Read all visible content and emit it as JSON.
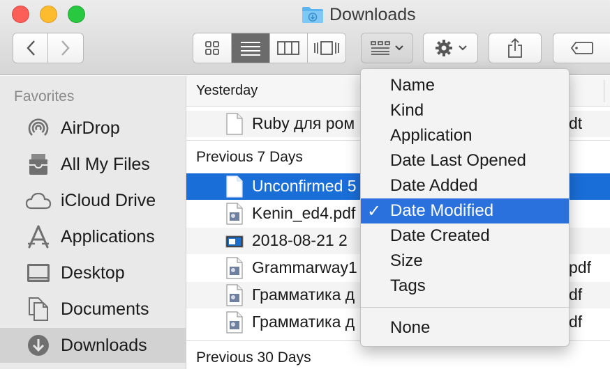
{
  "window": {
    "title": "Downloads"
  },
  "toolbar": {
    "back_icon": "chevron-left-icon",
    "forward_icon": "chevron-right-icon",
    "view_modes": [
      "icon-view-icon",
      "list-view-icon",
      "column-view-icon",
      "cover-flow-icon"
    ],
    "active_view": "list-view-icon",
    "group_icon": "group-by-icon",
    "action_icon": "gear-icon",
    "share_icon": "share-icon",
    "tag_icon": "tag-icon"
  },
  "sidebar": {
    "heading": "Favorites",
    "items": [
      {
        "label": "AirDrop",
        "icon": "airdrop-icon"
      },
      {
        "label": "All My Files",
        "icon": "all-files-icon"
      },
      {
        "label": "iCloud Drive",
        "icon": "cloud-icon"
      },
      {
        "label": "Applications",
        "icon": "applications-icon"
      },
      {
        "label": "Desktop",
        "icon": "desktop-icon"
      },
      {
        "label": "Documents",
        "icon": "documents-icon"
      },
      {
        "label": "Downloads",
        "icon": "downloads-icon"
      }
    ],
    "selected": "Downloads"
  },
  "list": {
    "groups": [
      {
        "label": "Yesterday",
        "rows": [
          {
            "name": "Ruby для ром",
            "ext": "dt"
          }
        ]
      },
      {
        "label": "Previous 7 Days",
        "rows": [
          {
            "name": "Unconfirmed 5",
            "ext": ""
          },
          {
            "name": "Kenin_ed4.pdf",
            "ext": ""
          },
          {
            "name": "2018-08-21 2",
            "ext": ""
          },
          {
            "name": "Grammarway1",
            "ext": "pdf"
          },
          {
            "name": "Грамматика д",
            "ext": "df"
          },
          {
            "name": "Грамматика д",
            "ext": "df"
          }
        ]
      },
      {
        "label": "Previous 30 Days",
        "rows": []
      }
    ]
  },
  "menu": {
    "items": [
      "Name",
      "Kind",
      "Application",
      "Date Last Opened",
      "Date Added",
      "Date Modified",
      "Date Created",
      "Size",
      "Tags"
    ],
    "checked": "Date Modified",
    "check_mark": "✓",
    "after_separator": "None"
  },
  "colors": {
    "selection_blue": "#1a6ed8",
    "menu_highlight": "#2b71dd",
    "folder_blue": "#5bb4f0"
  }
}
